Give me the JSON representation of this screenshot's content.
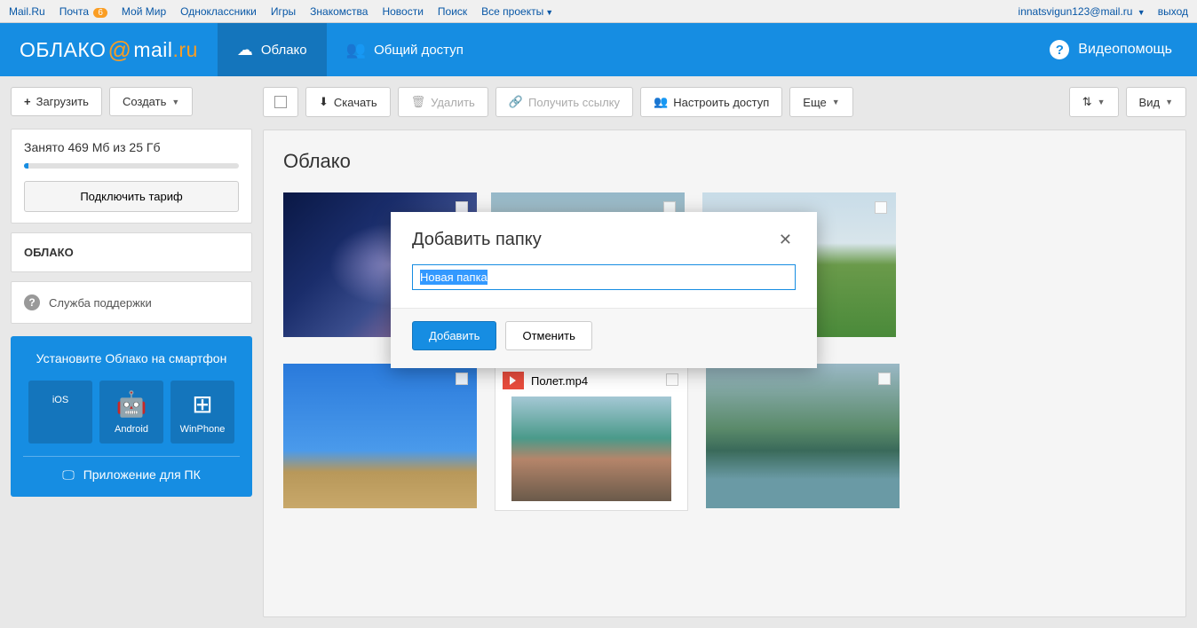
{
  "topbar": {
    "links": [
      "Mail.Ru",
      "Почта",
      "Мой Мир",
      "Одноклассники",
      "Игры",
      "Знакомства",
      "Новости",
      "Поиск",
      "Все проекты"
    ],
    "mail_badge": "6",
    "user_email": "innatsvigun123@mail.ru",
    "logout": "выход"
  },
  "header": {
    "logo_oblako": "ОБЛАКО",
    "logo_mail": "mail",
    "logo_ru": ".ru",
    "tab_cloud": "Облако",
    "tab_share": "Общий доступ",
    "help": "Видеопомощь"
  },
  "sidebar": {
    "upload": "Загрузить",
    "create": "Создать",
    "storage": "Занято 469 Мб из 25 Гб",
    "tariff": "Подключить тариф",
    "folder_label": "ОБЛАКО",
    "support": "Служба поддержки",
    "promo_title": "Установите Облако на смартфон",
    "apps": {
      "ios": "iOS",
      "android": "Android",
      "winphone": "WinPhone"
    },
    "pc_app": "Приложение для ПК"
  },
  "toolbar": {
    "download": "Скачать",
    "delete": "Удалить",
    "getlink": "Получить ссылку",
    "access": "Настроить доступ",
    "more": "Еще",
    "view": "Вид"
  },
  "content": {
    "breadcrumb": "Облако",
    "video_name": "Полет.mp4"
  },
  "modal": {
    "title": "Добавить папку",
    "input_value": "Новая папка",
    "add": "Добавить",
    "cancel": "Отменить"
  }
}
